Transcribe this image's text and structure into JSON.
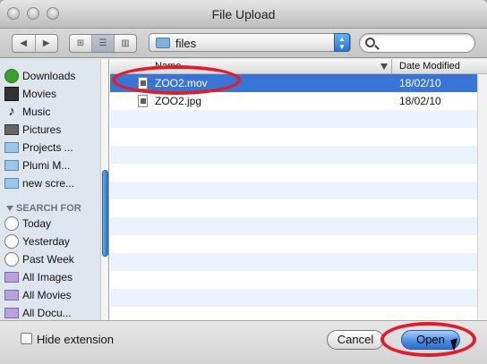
{
  "window": {
    "title": "File Upload"
  },
  "toolbar": {
    "back_icon": "back-arrow-icon",
    "forward_icon": "forward-arrow-icon",
    "view_modes": [
      "icon-view",
      "list-view",
      "column-view"
    ],
    "location": "files",
    "search_placeholder": ""
  },
  "sidebar": {
    "items": [
      {
        "label": "Downloads",
        "icon": "downloads-icon"
      },
      {
        "label": "Movies",
        "icon": "movies-icon"
      },
      {
        "label": "Music",
        "icon": "music-icon"
      },
      {
        "label": "Pictures",
        "icon": "pictures-icon"
      },
      {
        "label": "Projects ...",
        "icon": "folder-icon"
      },
      {
        "label": "Plumi M...",
        "icon": "folder-icon"
      },
      {
        "label": "new scre...",
        "icon": "folder-icon"
      }
    ],
    "search_heading": "SEARCH FOR",
    "search_items": [
      {
        "label": "Today",
        "icon": "clock-icon"
      },
      {
        "label": "Yesterday",
        "icon": "clock-icon"
      },
      {
        "label": "Past Week",
        "icon": "clock-icon"
      },
      {
        "label": "All Images",
        "icon": "smart-folder-icon"
      },
      {
        "label": "All Movies",
        "icon": "smart-folder-icon"
      },
      {
        "label": "All Docu...",
        "icon": "smart-folder-icon"
      }
    ]
  },
  "file_list": {
    "columns": [
      "Name",
      "Date Modified"
    ],
    "rows": [
      {
        "name": "ZOO2.mov",
        "date": "18/02/10",
        "selected": true
      },
      {
        "name": "ZOO2.jpg",
        "date": "18/02/10",
        "selected": false
      }
    ]
  },
  "bottom": {
    "hide_extension": "Hide extension",
    "cancel": "Cancel",
    "open": "Open"
  },
  "colors": {
    "selection": "#3875d7",
    "annotation": "#e01e2b",
    "sidebar": "#dfe5ec"
  }
}
